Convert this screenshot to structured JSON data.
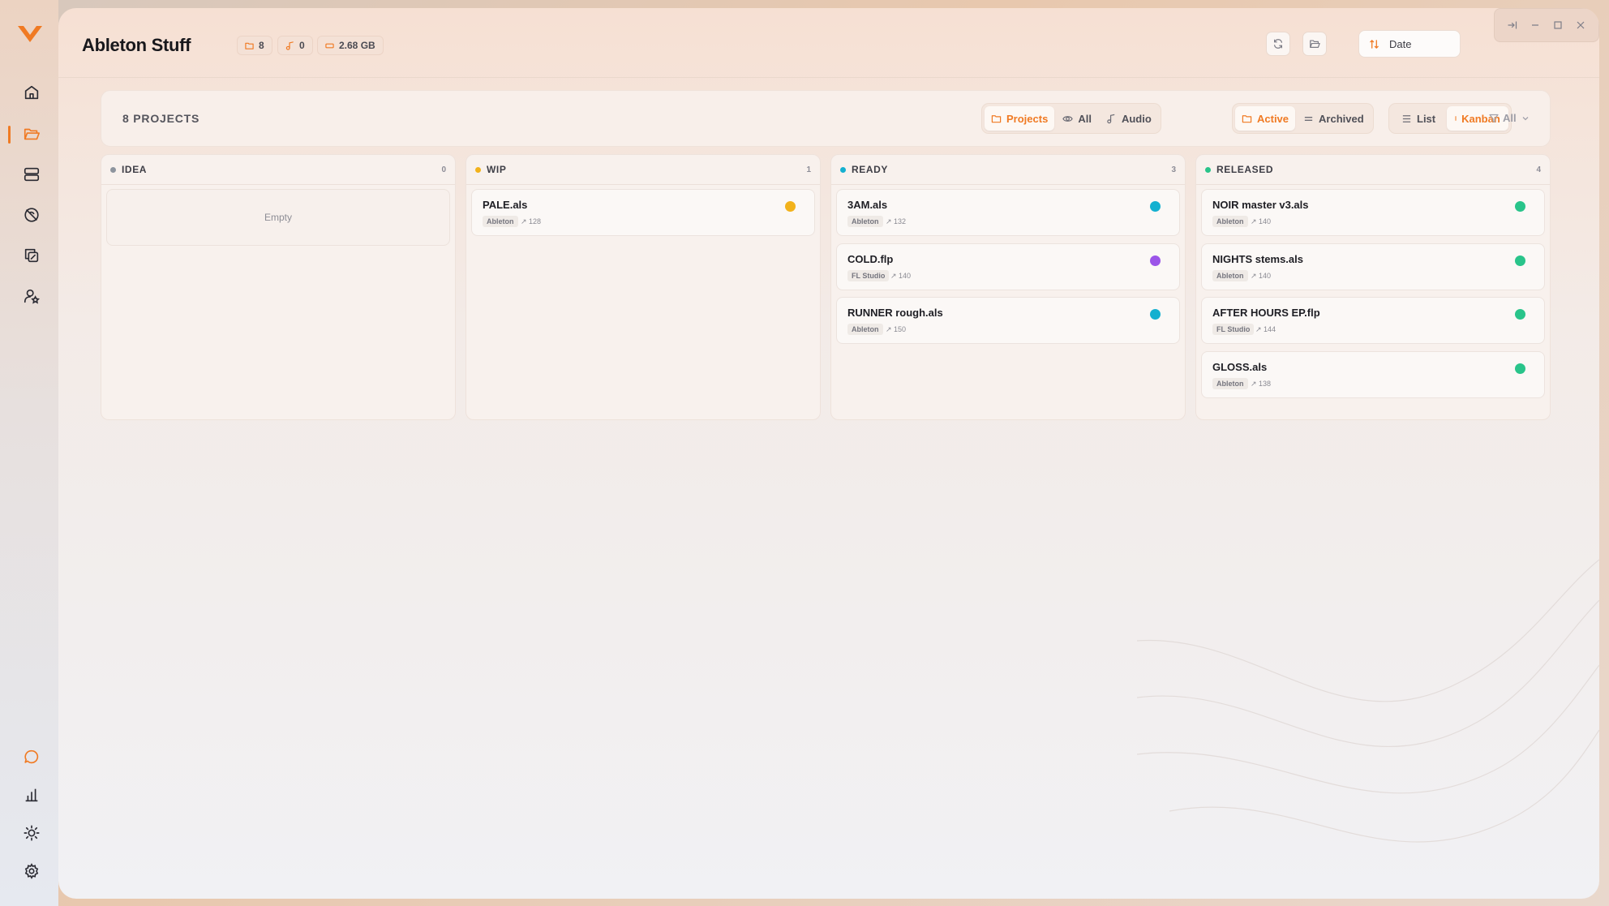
{
  "app": {
    "logo": "v-logo-icon",
    "accent_color": "#f07a23"
  },
  "sidebar": {
    "top_items": [
      {
        "name": "home",
        "icon": "home-icon"
      },
      {
        "name": "projects",
        "icon": "folder-open-icon",
        "active": true
      },
      {
        "name": "library",
        "icon": "server-icon"
      },
      {
        "name": "plugins",
        "icon": "disc-off-icon"
      },
      {
        "name": "collaborate",
        "icon": "copy-icon"
      },
      {
        "name": "profile",
        "icon": "user-star-icon"
      }
    ],
    "bottom_items": [
      {
        "name": "chat",
        "icon": "chat-bubble-icon"
      },
      {
        "name": "stats",
        "icon": "bar-chart-icon"
      },
      {
        "name": "theme",
        "icon": "sun-icon"
      },
      {
        "name": "settings",
        "icon": "gear-icon"
      }
    ]
  },
  "header": {
    "title": "Ableton Stuff",
    "stats": {
      "folders": "8",
      "audio": "0",
      "size": "2.68 GB"
    },
    "sort_label": "Date"
  },
  "toolbar": {
    "project_count": "8 PROJECTS",
    "type_filter": [
      {
        "label": "Projects",
        "icon": "folder-icon",
        "active": true
      },
      {
        "label": "All",
        "icon": "eye-icon",
        "active": false
      },
      {
        "label": "Audio",
        "icon": "music-note-icon",
        "active": false
      }
    ],
    "state_filter": [
      {
        "label": "Active",
        "icon": "folder-icon",
        "active": true
      },
      {
        "label": "Archived",
        "icon": "archive-icon",
        "active": false
      }
    ],
    "view_mode": [
      {
        "label": "List",
        "icon": "list-icon",
        "active": false
      },
      {
        "label": "Kanban",
        "icon": "kanban-icon",
        "active": true
      }
    ],
    "filter_label": "All"
  },
  "kanban": {
    "columns": [
      {
        "title": "IDEA",
        "count": "0",
        "color": "#8d949e",
        "empty_label": "Empty",
        "cards": []
      },
      {
        "title": "WIP",
        "count": "1",
        "color": "#f2b21b",
        "cards": [
          {
            "name": "PALE.als",
            "daw": "Ableton",
            "bpm": "128",
            "status_color": "#f2b21b"
          }
        ]
      },
      {
        "title": "READY",
        "count": "3",
        "color": "#14b0d0",
        "cards": [
          {
            "name": "3AM.als",
            "daw": "Ableton",
            "bpm": "132",
            "status_color": "#14b0d0"
          },
          {
            "name": "COLD.flp",
            "daw": "FL Studio",
            "bpm": "140",
            "status_color": "#9b55e8"
          },
          {
            "name": "RUNNER rough.als",
            "daw": "Ableton",
            "bpm": "150",
            "status_color": "#14b0d0"
          }
        ]
      },
      {
        "title": "RELEASED",
        "count": "4",
        "color": "#29c48a",
        "cards": [
          {
            "name": "NOIR master v3.als",
            "daw": "Ableton",
            "bpm": "140",
            "status_color": "#29c48a"
          },
          {
            "name": "NIGHTS stems.als",
            "daw": "Ableton",
            "bpm": "140",
            "status_color": "#29c48a"
          },
          {
            "name": "AFTER HOURS EP.flp",
            "daw": "FL Studio",
            "bpm": "144",
            "status_color": "#29c48a"
          },
          {
            "name": "GLOSS.als",
            "daw": "Ableton",
            "bpm": "138",
            "status_color": "#29c48a"
          }
        ]
      }
    ]
  }
}
